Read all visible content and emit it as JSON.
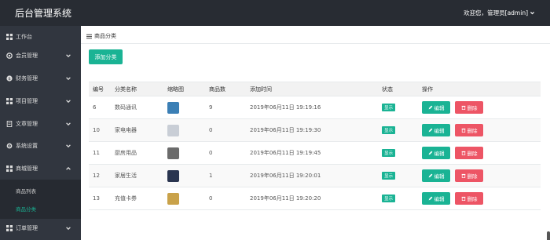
{
  "app": {
    "title": "后台管理系统"
  },
  "user": {
    "greeting": "欢迎您，管理员[admin]"
  },
  "sidebar": {
    "items": [
      {
        "label": "工作台"
      },
      {
        "label": "会员管理"
      },
      {
        "label": "财务管理"
      },
      {
        "label": "项目管理"
      },
      {
        "label": "文章管理"
      },
      {
        "label": "系统设置"
      },
      {
        "label": "商城管理"
      },
      {
        "label": "订单管理"
      }
    ],
    "sub_items": [
      {
        "label": "商品列表"
      },
      {
        "label": "商品分类",
        "active": true
      }
    ]
  },
  "breadcrumb": {
    "label": "商品分类"
  },
  "toolbar": {
    "add_label": "添加分类"
  },
  "table": {
    "headers": [
      "编号",
      "分类名称",
      "缩略图",
      "商品数",
      "添加时间",
      "状态",
      "操作"
    ],
    "rows": [
      {
        "id": "6",
        "name": "数码通讯",
        "count": "9",
        "time": "2019年06月11日 19:19:16",
        "status": "显示",
        "thumb_color": "#3b7fb5"
      },
      {
        "id": "10",
        "name": "家电电器",
        "count": "0",
        "time": "2019年06月11日 19:19:30",
        "status": "显示",
        "thumb_color": "#c9ced6"
      },
      {
        "id": "11",
        "name": "厨房用品",
        "count": "0",
        "time": "2019年06月11日 19:19:45",
        "status": "显示",
        "thumb_color": "#6b6b6b"
      },
      {
        "id": "12",
        "name": "家居生活",
        "count": "1",
        "time": "2019年06月11日 19:20:01",
        "status": "显示",
        "thumb_color": "#2a3550"
      },
      {
        "id": "13",
        "name": "充值卡券",
        "count": "0",
        "time": "2019年06月11日 19:20:20",
        "status": "显示",
        "thumb_color": "#c9a24a"
      }
    ],
    "edit_label": "编辑",
    "delete_label": "删除"
  },
  "colors": {
    "accent": "#1ab394",
    "danger": "#ed5565",
    "topbar": "#282c33",
    "sidebar": "#31363f"
  }
}
